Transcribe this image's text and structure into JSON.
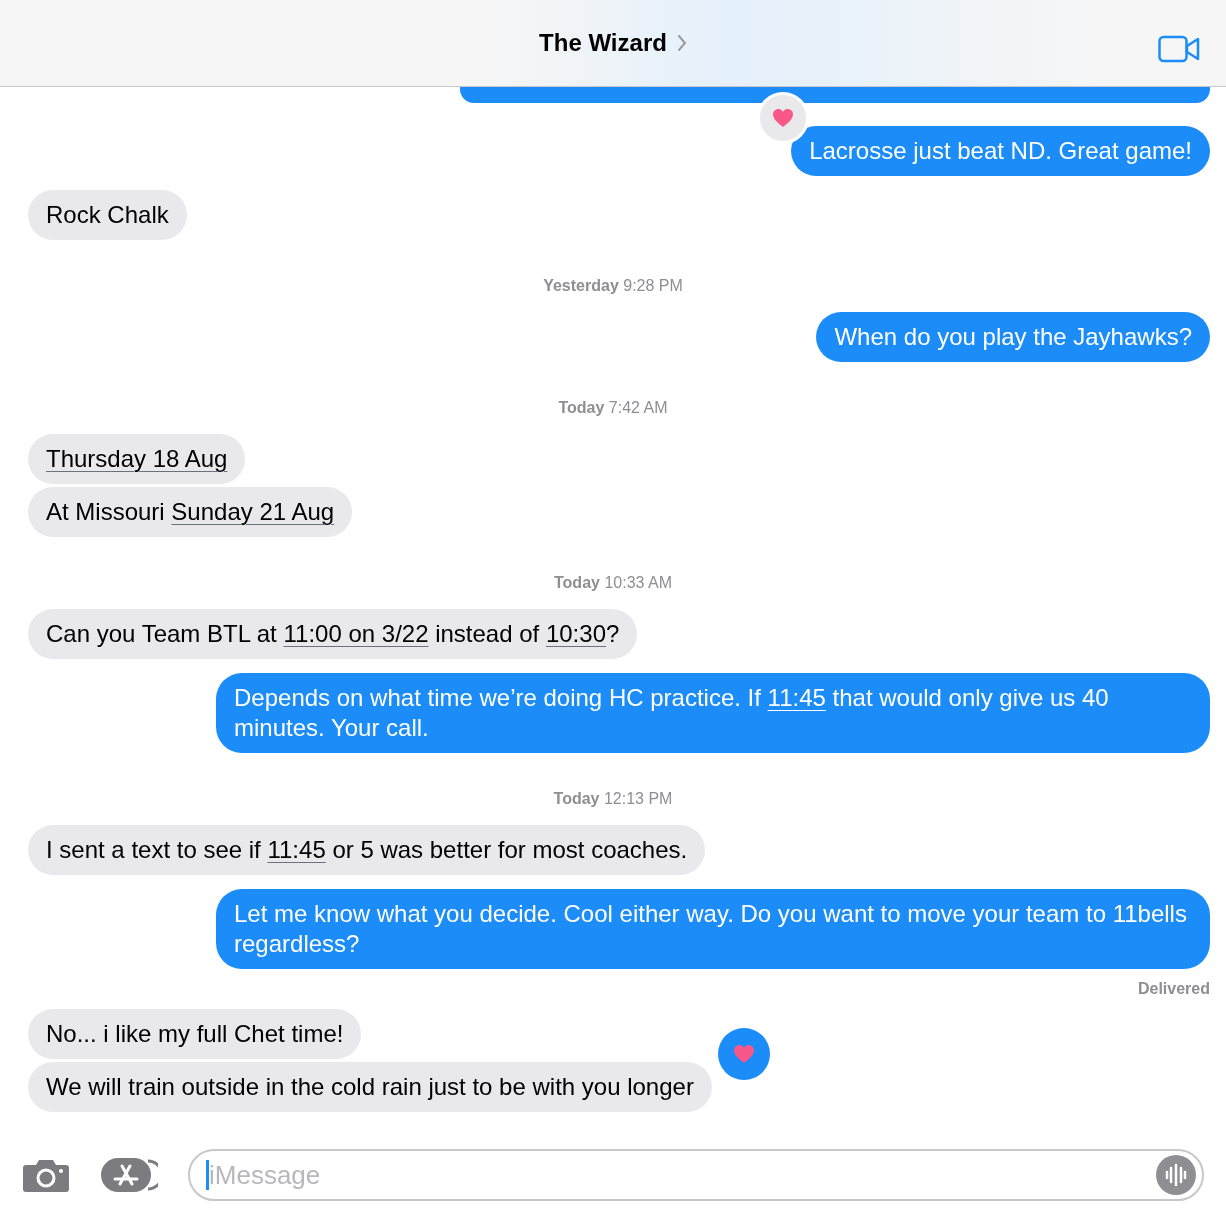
{
  "header": {
    "title": "The Wizard"
  },
  "messages": [
    {
      "kind": "clipped",
      "outgoing": true
    },
    {
      "kind": "message",
      "outgoing": true,
      "parts": [
        {
          "text": "Lacrosse just beat ND. Great game!",
          "link": false
        }
      ],
      "reaction": {
        "kind": "heart",
        "mine": false
      }
    },
    {
      "kind": "message",
      "outgoing": false,
      "parts": [
        {
          "text": "Rock Chalk",
          "link": false
        }
      ]
    },
    {
      "kind": "timestamp",
      "day": "Yesterday",
      "time": "9:28 PM"
    },
    {
      "kind": "message",
      "outgoing": true,
      "parts": [
        {
          "text": "When do you play the Jayhawks?",
          "link": false
        }
      ]
    },
    {
      "kind": "timestamp",
      "day": "Today",
      "time": "7:42 AM"
    },
    {
      "kind": "message",
      "outgoing": false,
      "parts": [
        {
          "text": "Thursday 18 Aug",
          "link": true
        }
      ]
    },
    {
      "kind": "message",
      "outgoing": false,
      "parts": [
        {
          "text": "At Missouri ",
          "link": false
        },
        {
          "text": "Sunday 21 Aug",
          "link": true
        }
      ]
    },
    {
      "kind": "timestamp",
      "day": "Today",
      "time": "10:33 AM"
    },
    {
      "kind": "message",
      "outgoing": false,
      "parts": [
        {
          "text": "Can you Team BTL at ",
          "link": false
        },
        {
          "text": "11:00 on 3/22",
          "link": true
        },
        {
          "text": " instead of ",
          "link": false
        },
        {
          "text": "10:30",
          "link": true
        },
        {
          "text": "?",
          "link": false
        }
      ]
    },
    {
      "kind": "message",
      "outgoing": true,
      "parts": [
        {
          "text": "Depends on what time we’re doing HC practice. If ",
          "link": false
        },
        {
          "text": "11:45",
          "link": true
        },
        {
          "text": " that would only give us 40 minutes. Your call.",
          "link": false
        }
      ]
    },
    {
      "kind": "timestamp",
      "day": "Today",
      "time": "12:13 PM"
    },
    {
      "kind": "message",
      "outgoing": false,
      "parts": [
        {
          "text": "I sent a text to see if ",
          "link": false
        },
        {
          "text": "11:45",
          "link": true
        },
        {
          "text": " or 5 was better for most coaches.",
          "link": false
        }
      ]
    },
    {
      "kind": "message",
      "outgoing": true,
      "parts": [
        {
          "text": "Let me know what you decide. Cool either way. Do you want to move your team to 11bells regardless?",
          "link": false
        }
      ]
    },
    {
      "kind": "status",
      "text": "Delivered"
    },
    {
      "kind": "message",
      "outgoing": false,
      "parts": [
        {
          "text": "No... i like my full Chet time!",
          "link": false
        }
      ]
    },
    {
      "kind": "message",
      "outgoing": false,
      "parts": [
        {
          "text": "We will train outside in the cold rain just to be with you longer",
          "link": false
        }
      ],
      "reaction": {
        "kind": "heart",
        "mine": true
      }
    }
  ],
  "composer": {
    "placeholder": "iMessage"
  }
}
